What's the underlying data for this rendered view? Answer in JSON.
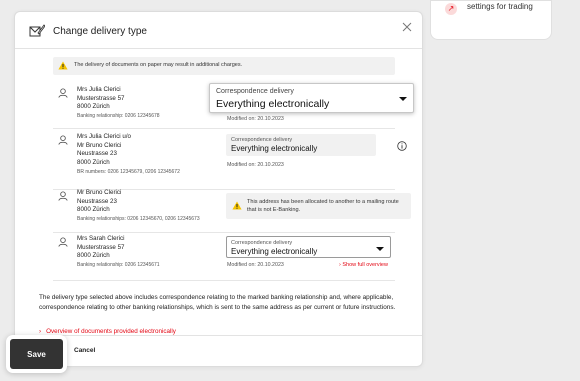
{
  "background": {
    "settings_card_label": "settings for trading"
  },
  "modal": {
    "title": "Change delivery type",
    "notice": "The delivery of documents on paper may result in additional charges.",
    "rows": [
      {
        "lines": [
          "Mrs Julia Clerici",
          "Musterstrasse 57",
          "8000 Zürich"
        ],
        "meta": "Banking relationship: 0206 12345678",
        "select_label": "Correspondence delivery",
        "select_value": "Everything electronically",
        "modified": "Modified on: 20.10.2023"
      },
      {
        "lines": [
          "Mrs Julia Clerici u/o",
          "Mr Bruno Clerici",
          "Neustrasse 23",
          "8000 Zürich"
        ],
        "meta": "BR numbers: 0206 12345679, 0206 12345672",
        "select_label": "Correspondence delivery",
        "select_value": "Everything electronically",
        "modified": "Modified on: 20.10.2023"
      },
      {
        "lines": [
          "Mr Bruno Clerici",
          "Neustrasse 23",
          "8000 Zürich"
        ],
        "meta": "Banking relationships: 0206 12345670, 0206 12345673",
        "alert": "This address has been allocated to another to a mailing route that is not E-Banking."
      },
      {
        "lines": [
          "Mrs Sarah Clerici",
          "Musterstrasse 57",
          "8000 Zürich"
        ],
        "meta": "Banking relationship: 0206 12345671",
        "select_label": "Correspondence delivery",
        "select_value": "Everything electronically",
        "modified": "Modified on: 20.10.2023",
        "show_full": "Show full overview"
      }
    ],
    "description": "The delivery type selected above includes correspondence relating to the marked banking relationship and, where applicable, correspondence relating to other banking relationships, which is sent to the same address as per current or future instructions.",
    "overview_link": "Overview of documents provided electronically",
    "save_label": "Save",
    "cancel_label": "Cancel"
  },
  "colors": {
    "accent_red": "#e30613",
    "save_button": "#333333",
    "warning_yellow": "#f5c400"
  }
}
